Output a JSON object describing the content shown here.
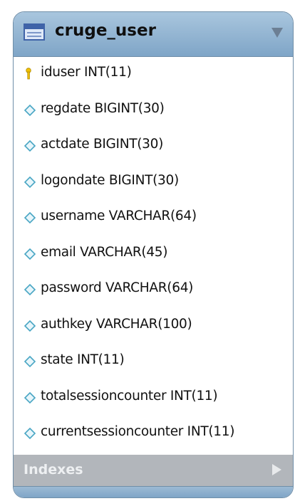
{
  "table": {
    "name": "cruge_user",
    "header_color": "#8fb1cf",
    "columns": [
      {
        "text": "iduser INT(11)",
        "icon": "primary-key-icon"
      },
      {
        "text": "regdate BIGINT(30)",
        "icon": "column-diamond-icon"
      },
      {
        "text": "actdate BIGINT(30)",
        "icon": "column-diamond-icon"
      },
      {
        "text": "logondate BIGINT(30)",
        "icon": "column-diamond-icon"
      },
      {
        "text": "username VARCHAR(64)",
        "icon": "column-diamond-icon"
      },
      {
        "text": "email VARCHAR(45)",
        "icon": "column-diamond-icon"
      },
      {
        "text": "password VARCHAR(64)",
        "icon": "column-diamond-icon"
      },
      {
        "text": "authkey VARCHAR(100)",
        "icon": "column-diamond-icon"
      },
      {
        "text": "state INT(11)",
        "icon": "column-diamond-icon"
      },
      {
        "text": "totalsessioncounter INT(11)",
        "icon": "column-diamond-icon"
      },
      {
        "text": "currentsessioncounter INT(11)",
        "icon": "column-diamond-icon"
      }
    ],
    "indexes_label": "Indexes"
  }
}
